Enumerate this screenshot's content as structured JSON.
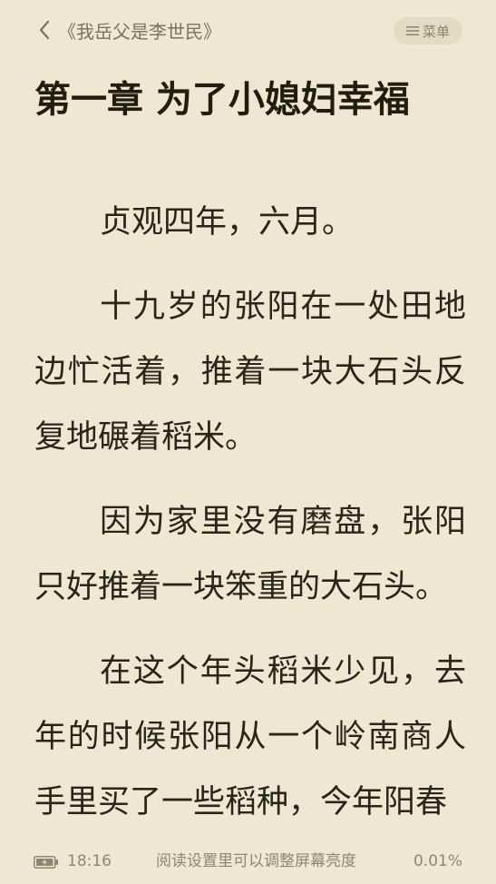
{
  "header": {
    "back_icon": "chevron-left-icon",
    "book_title": "《我岳父是李世民》",
    "menu_icon": "hamburger-menu-icon",
    "menu_label": "菜单"
  },
  "chapter": {
    "title": "第一章 为了小媳妇幸福"
  },
  "paragraphs": [
    "贞观四年，六月。",
    "十九岁的张阳在一处田地边忙活着，推着一块大石头反复地碾着稻米。",
    "因为家里没有磨盘，张阳只好推着一块笨重的大石头。",
    "在这个年头稻米少见，去年的时候张阳从一个岭南商人手里买了一些稻种，今年阳春"
  ],
  "status": {
    "battery_icon": "battery-charging-icon",
    "time": "18:16",
    "hint": "阅读设置里可以调整屏幕亮度",
    "progress": "0.01%"
  },
  "colors": {
    "background": "#efe7d2",
    "text": "#2b2519",
    "muted": "#8e8674",
    "menu_pill": "#e3dbc4"
  }
}
